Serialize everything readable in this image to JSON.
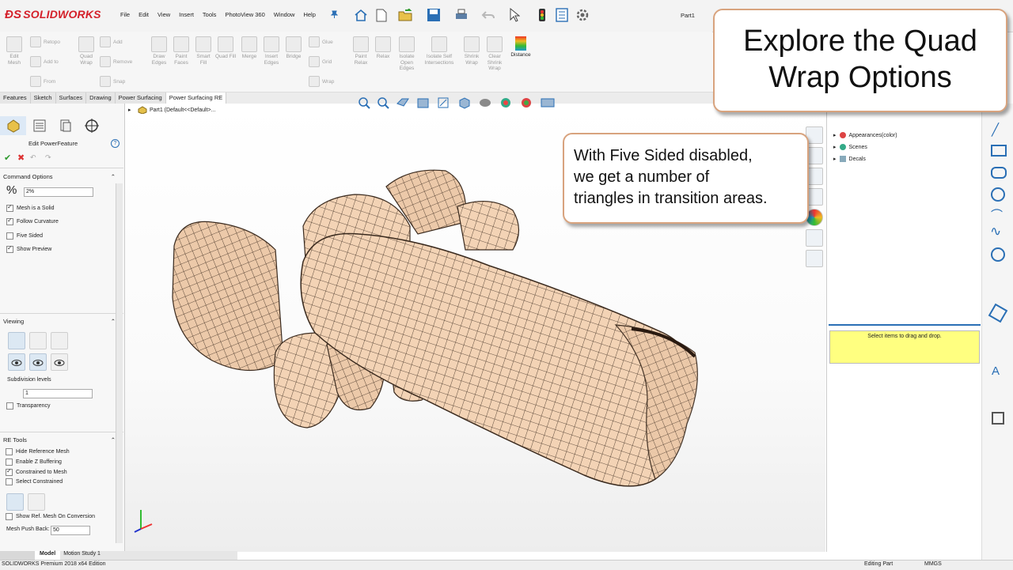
{
  "app": {
    "logo_text": "SOLIDWORKS",
    "document_title": "Part1",
    "menus": [
      "File",
      "Edit",
      "View",
      "Insert",
      "Tools",
      "PhotoView 360",
      "Window",
      "Help"
    ]
  },
  "command_manager": {
    "buttons": [
      {
        "label": "Edit Mesh",
        "icon": "edit-mesh-icon"
      },
      {
        "label": "Quad Wrap",
        "icon": "quad-wrap-icon"
      },
      {
        "label": "Draw Edges",
        "icon": "draw-edges-icon"
      },
      {
        "label": "Paint Faces",
        "icon": "paint-faces-icon"
      },
      {
        "label": "Smart Fill",
        "icon": "smart-fill-icon"
      },
      {
        "label": "Quad Fill",
        "icon": "quad-fill-icon"
      },
      {
        "label": "Merge",
        "icon": "merge-icon"
      },
      {
        "label": "Insert Edges",
        "icon": "insert-edges-icon"
      },
      {
        "label": "Bridge",
        "icon": "bridge-icon"
      },
      {
        "label": "Paint Relax",
        "icon": "paint-relax-icon"
      },
      {
        "label": "Relax",
        "icon": "relax-icon"
      },
      {
        "label": "Isolate Open Edges",
        "icon": "isolate-open-edges-icon"
      },
      {
        "label": "Isolate Self Intersections",
        "icon": "isolate-self-intersections-icon"
      },
      {
        "label": "Shrink Wrap",
        "icon": "shrink-wrap-icon"
      },
      {
        "label": "Clear Shrink Wrap",
        "icon": "clear-shrink-wrap-icon"
      },
      {
        "label": "Distance",
        "icon": "distance-icon"
      }
    ],
    "side_buttons": {
      "retopo": "Retopo",
      "add_to": "Add to",
      "from": "From",
      "add": "Add",
      "remove": "Remove",
      "snap": "Snap",
      "glue": "Glue",
      "grid": "Grid",
      "wrap": "Wrap"
    }
  },
  "tabs": [
    "Features",
    "Sketch",
    "Surfaces",
    "Drawing",
    "Power Surfacing",
    "Power Surfacing RE"
  ],
  "active_tab": "Power Surfacing RE",
  "feature_tree": {
    "breadcrumb": "Part1  (Default<<Default>..."
  },
  "property_manager": {
    "title": "Edit PowerFeature",
    "command_options": {
      "header": "Command Options",
      "percent_symbol": "%",
      "percent_value": "2%",
      "mesh_is_solid": {
        "label": "Mesh is a Solid",
        "checked": true
      },
      "follow_curvature": {
        "label": "Follow Curvature",
        "checked": true
      },
      "five_sided": {
        "label": "Five Sided",
        "checked": false
      },
      "show_preview": {
        "label": "Show Preview",
        "checked": true
      }
    },
    "viewing": {
      "header": "Viewing",
      "subdivision_label": "Subdivision levels",
      "subdivision_value": "1",
      "transparency": {
        "label": "Transparency",
        "checked": false
      }
    },
    "re_tools": {
      "header": "RE Tools",
      "hide_reference_mesh": {
        "label": "Hide Reference Mesh",
        "checked": false
      },
      "enable_z_buffering": {
        "label": "Enable Z Buffering",
        "checked": false
      },
      "constrained_to_mesh": {
        "label": "Constrained to Mesh",
        "checked": true
      },
      "select_constrained": {
        "label": "Select Constrained",
        "checked": false
      },
      "show_ref_mesh": {
        "label": "Show Ref. Mesh On Conversion",
        "checked": false
      },
      "mesh_push_back_label": "Mesh Push Back:",
      "mesh_push_back_value": "50"
    }
  },
  "task_pane": {
    "items": [
      "Appearances(color)",
      "Scenes",
      "Decals"
    ],
    "drop_hint": "Select items to drag and drop."
  },
  "bottom_tabs": [
    "Model",
    "Motion Study 1"
  ],
  "status": {
    "edition": "SOLIDWORKS Premium 2018 x64 Edition",
    "mode": "Editing Part",
    "units": "MMGS"
  },
  "callouts": {
    "main_line1": "Explore the Quad",
    "main_line2": "Wrap Options",
    "sub_line1": "With Five Sided disabled,",
    "sub_line2": "we get a number of",
    "sub_line3": "triangles in transition areas."
  },
  "colors": {
    "brand_red": "#d4202a",
    "mesh_fill": "#f3d3b5",
    "mesh_line": "#3a2a1e",
    "callout_border": "#d8a37e",
    "drop_zone": "#ffff80"
  }
}
